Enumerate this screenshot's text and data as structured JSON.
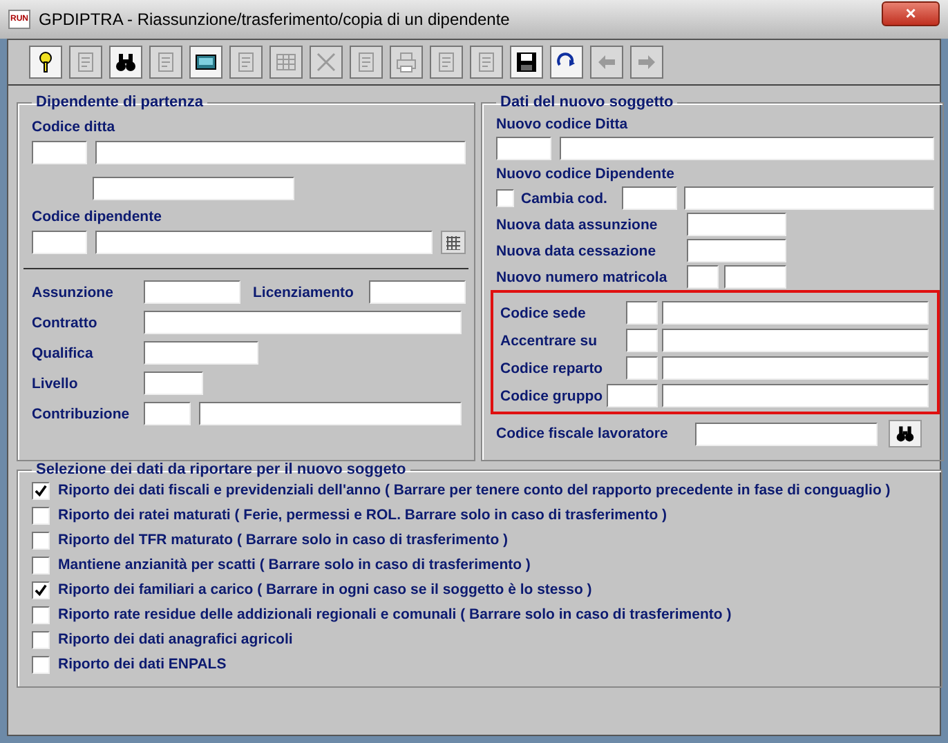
{
  "window": {
    "title": "GPDIPTRA - Riassunzione/trasferimento/copia di un dipendente",
    "app_badge": "RUN",
    "close": "×"
  },
  "toolbar": [
    {
      "kind": "help",
      "disabled": false
    },
    {
      "kind": "edit",
      "disabled": true
    },
    {
      "kind": "binoculars",
      "disabled": false
    },
    {
      "kind": "copy",
      "disabled": true
    },
    {
      "kind": "monitor",
      "disabled": false
    },
    {
      "kind": "pages",
      "disabled": true
    },
    {
      "kind": "grid",
      "disabled": true
    },
    {
      "kind": "delete",
      "disabled": true
    },
    {
      "kind": "preview",
      "disabled": true
    },
    {
      "kind": "print",
      "disabled": true
    },
    {
      "kind": "export",
      "disabled": true
    },
    {
      "kind": "form",
      "disabled": true
    },
    {
      "kind": "save",
      "disabled": false
    },
    {
      "kind": "redo",
      "disabled": false
    },
    {
      "kind": "back",
      "disabled": true
    },
    {
      "kind": "forward",
      "disabled": true
    }
  ],
  "left_panel": {
    "title": "Dipendente di partenza",
    "company_label": "Codice ditta",
    "employee_label": "Codice dipendente",
    "hire_label": "Assunzione",
    "dismissal_label": "Licenziamento",
    "contract_label": "Contratto",
    "qualification_label": "Qualifica",
    "level_label": "Livello",
    "contribution_label": "Contribuzione"
  },
  "right_panel": {
    "title": "Dati del nuovo soggetto",
    "new_company_label": "Nuovo codice Ditta",
    "new_employee_label": "Nuovo codice Dipendente",
    "change_code": {
      "label": "Cambia cod.",
      "checked": false
    },
    "hire_date_label": "Nuova data assunzione",
    "end_date_label": "Nuova data cessazione",
    "number_label": "Nuovo numero matricola",
    "highlighted_rows": [
      {
        "label": "Codice sede",
        "kind": "short"
      },
      {
        "label": "Accentrare su",
        "kind": "short"
      },
      {
        "label": "Codice reparto",
        "kind": "short"
      },
      {
        "label": "Codice gruppo",
        "kind": "long"
      }
    ],
    "tax_code_label": "Codice fiscale lavoratore"
  },
  "selection": {
    "title": "Selezione dei dati da riportare per il nuovo soggeto",
    "options": [
      {
        "label": "Riporto dei dati fiscali e previdenziali dell'anno ( Barrare per tenere conto del rapporto precedente in fase di conguaglio )",
        "checked": true
      },
      {
        "label": "Riporto dei ratei maturati ( Ferie, permessi e ROL. Barrare solo in caso di trasferimento )",
        "checked": false
      },
      {
        "label": "Riporto del TFR maturato ( Barrare solo in caso di trasferimento )",
        "checked": false
      },
      {
        "label": "Mantiene anzianità per scatti ( Barrare solo in caso di trasferimento )",
        "checked": false
      },
      {
        "label": "Riporto dei familiari a carico ( Barrare in ogni caso se il soggetto è lo stesso )",
        "checked": true
      },
      {
        "label": "Riporto rate residue delle addizionali regionali e comunali ( Barrare solo in caso di trasferimento )",
        "checked": false
      },
      {
        "label": "Riporto dei dati anagrafici agricoli",
        "checked": false
      },
      {
        "label": "Riporto dei dati ENPALS",
        "checked": false
      }
    ]
  }
}
